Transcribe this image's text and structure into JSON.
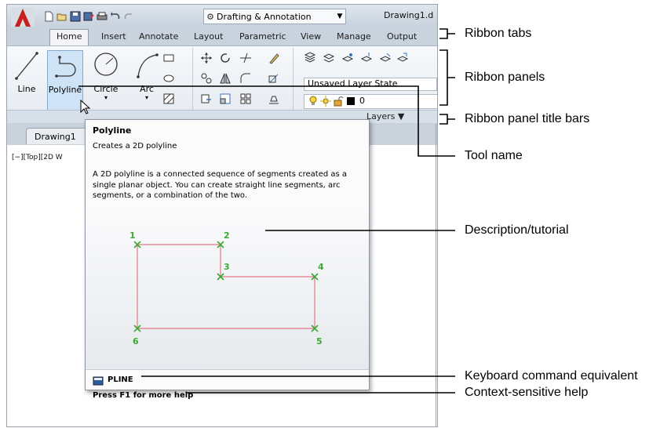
{
  "titlebar": {
    "workspace": "Drafting & Annotation",
    "document_title": "Drawing1.d"
  },
  "tabs": [
    "Home",
    "Insert",
    "Annotate",
    "Layout",
    "Parametric",
    "View",
    "Manage",
    "Output"
  ],
  "ribbon": {
    "tools": [
      "Line",
      "Polyline",
      "Circle",
      "Arc"
    ],
    "layer_state": "Unsaved Layer State",
    "layer_current": "0",
    "layers_title": "Layers ▼"
  },
  "drawing_tab": "Drawing1",
  "viewport_label": "[−][Top][2D W",
  "tooltip": {
    "title": "Polyline",
    "subtitle": "Creates a 2D polyline",
    "description": "A 2D polyline is a connected sequence of segments created as a single planar object. You can create straight line segments, arc segments, or a combination of the two.",
    "points": [
      "1",
      "2",
      "3",
      "4",
      "5",
      "6"
    ],
    "command": "PLINE",
    "help": "Press F1 for more help"
  },
  "annotations": {
    "ribbon_tabs": "Ribbon tabs",
    "ribbon_panels": "Ribbon panels",
    "panel_title_bars": "Ribbon panel title bars",
    "tool_name": "Tool name",
    "description": "Description/tutorial",
    "keyboard": "Keyboard command equivalent",
    "help": "Context-sensitive help"
  },
  "colors": {
    "app_red": "#c8201a",
    "polyline_pink": "#e07a86",
    "point_green": "#3aaa35"
  }
}
